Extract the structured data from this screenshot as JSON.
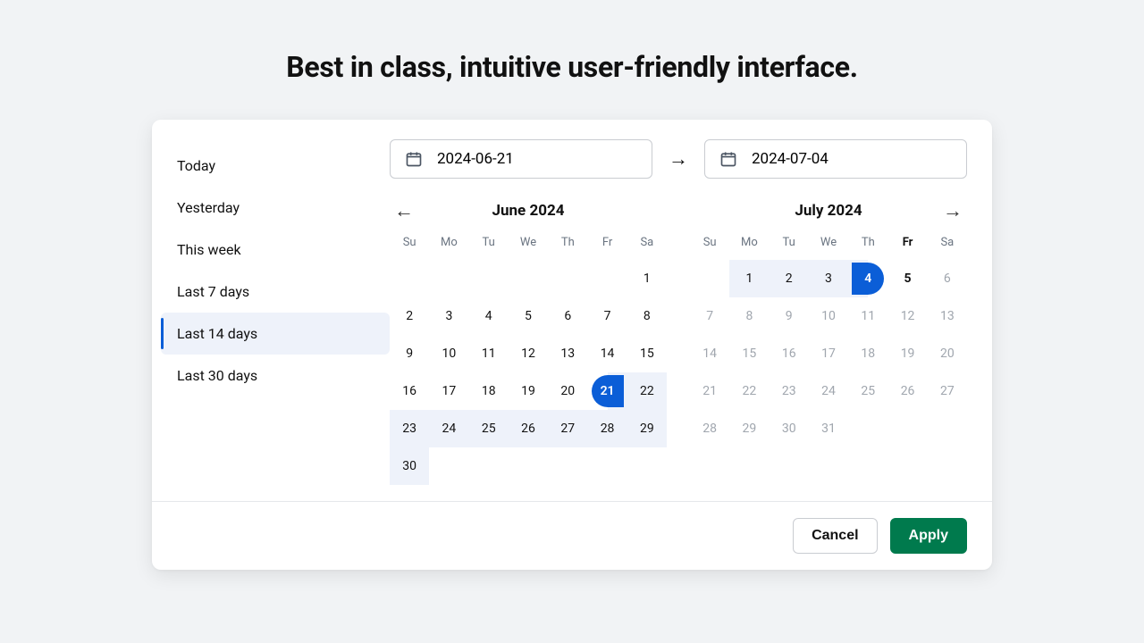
{
  "headline": "Best in class, intuitive user-friendly interface.",
  "presets": [
    {
      "label": "Today",
      "active": false
    },
    {
      "label": "Yesterday",
      "active": false
    },
    {
      "label": "This week",
      "active": false
    },
    {
      "label": "Last 7 days",
      "active": false
    },
    {
      "label": "Last 14 days",
      "active": true
    },
    {
      "label": "Last 30 days",
      "active": false
    }
  ],
  "inputs": {
    "start": "2024-06-21",
    "end": "2024-07-04"
  },
  "dow": [
    "Su",
    "Mo",
    "Tu",
    "We",
    "Th",
    "Fr",
    "Sa"
  ],
  "months": [
    {
      "title": "June 2024",
      "dow_bold": [],
      "prev_nav": true,
      "next_nav": false,
      "weeks": [
        [
          null,
          null,
          null,
          null,
          null,
          null,
          {
            "n": 1
          }
        ],
        [
          {
            "n": 2
          },
          {
            "n": 3
          },
          {
            "n": 4
          },
          {
            "n": 5
          },
          {
            "n": 6
          },
          {
            "n": 7
          },
          {
            "n": 8
          }
        ],
        [
          {
            "n": 9
          },
          {
            "n": 10
          },
          {
            "n": 11
          },
          {
            "n": 12
          },
          {
            "n": 13
          },
          {
            "n": 14
          },
          {
            "n": 15
          }
        ],
        [
          {
            "n": 16
          },
          {
            "n": 17
          },
          {
            "n": 18
          },
          {
            "n": 19
          },
          {
            "n": 20
          },
          {
            "n": 21,
            "sel": "start"
          },
          {
            "n": 22,
            "range": true
          }
        ],
        [
          {
            "n": 23,
            "range": true
          },
          {
            "n": 24,
            "range": true
          },
          {
            "n": 25,
            "range": true
          },
          {
            "n": 26,
            "range": true
          },
          {
            "n": 27,
            "range": true
          },
          {
            "n": 28,
            "range": true
          },
          {
            "n": 29,
            "range": true
          }
        ],
        [
          {
            "n": 30,
            "range": true
          },
          null,
          null,
          null,
          null,
          null,
          null
        ]
      ]
    },
    {
      "title": "July 2024",
      "dow_bold": [
        5
      ],
      "prev_nav": false,
      "next_nav": true,
      "weeks": [
        [
          null,
          {
            "n": 1,
            "range": true
          },
          {
            "n": 2,
            "range": true
          },
          {
            "n": 3,
            "range": true
          },
          {
            "n": 4,
            "sel": "end"
          },
          {
            "n": 5,
            "bold": true
          },
          {
            "n": 6,
            "muted": true
          }
        ],
        [
          {
            "n": 7,
            "muted": true
          },
          {
            "n": 8,
            "muted": true
          },
          {
            "n": 9,
            "muted": true
          },
          {
            "n": 10,
            "muted": true
          },
          {
            "n": 11,
            "muted": true
          },
          {
            "n": 12,
            "muted": true
          },
          {
            "n": 13,
            "muted": true
          }
        ],
        [
          {
            "n": 14,
            "muted": true
          },
          {
            "n": 15,
            "muted": true
          },
          {
            "n": 16,
            "muted": true
          },
          {
            "n": 17,
            "muted": true
          },
          {
            "n": 18,
            "muted": true
          },
          {
            "n": 19,
            "muted": true
          },
          {
            "n": 20,
            "muted": true
          }
        ],
        [
          {
            "n": 21,
            "muted": true
          },
          {
            "n": 22,
            "muted": true
          },
          {
            "n": 23,
            "muted": true
          },
          {
            "n": 24,
            "muted": true
          },
          {
            "n": 25,
            "muted": true
          },
          {
            "n": 26,
            "muted": true
          },
          {
            "n": 27,
            "muted": true
          }
        ],
        [
          {
            "n": 28,
            "muted": true
          },
          {
            "n": 29,
            "muted": true
          },
          {
            "n": 30,
            "muted": true
          },
          {
            "n": 31,
            "muted": true
          },
          null,
          null,
          null
        ]
      ]
    }
  ],
  "buttons": {
    "cancel": "Cancel",
    "apply": "Apply"
  }
}
